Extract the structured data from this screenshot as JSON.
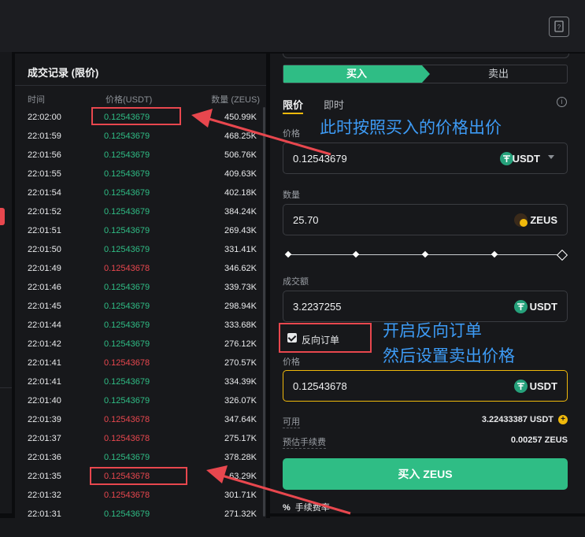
{
  "trades": {
    "title": "成交记录 (限价)",
    "col_time": "时间",
    "col_price": "价格(USDT)",
    "col_qty": "数量 (ZEUS)",
    "rows": [
      {
        "time": "22:02:00",
        "price": "0.12543679",
        "qty": "450.99K",
        "side": "buy"
      },
      {
        "time": "22:01:59",
        "price": "0.12543679",
        "qty": "468.25K",
        "side": "buy"
      },
      {
        "time": "22:01:56",
        "price": "0.12543679",
        "qty": "506.76K",
        "side": "buy"
      },
      {
        "time": "22:01:55",
        "price": "0.12543679",
        "qty": "409.63K",
        "side": "buy"
      },
      {
        "time": "22:01:54",
        "price": "0.12543679",
        "qty": "402.18K",
        "side": "buy"
      },
      {
        "time": "22:01:52",
        "price": "0.12543679",
        "qty": "384.24K",
        "side": "buy"
      },
      {
        "time": "22:01:51",
        "price": "0.12543679",
        "qty": "269.43K",
        "side": "buy"
      },
      {
        "time": "22:01:50",
        "price": "0.12543679",
        "qty": "331.41K",
        "side": "buy"
      },
      {
        "time": "22:01:49",
        "price": "0.12543678",
        "qty": "346.62K",
        "side": "sell"
      },
      {
        "time": "22:01:46",
        "price": "0.12543679",
        "qty": "339.73K",
        "side": "buy"
      },
      {
        "time": "22:01:45",
        "price": "0.12543679",
        "qty": "298.94K",
        "side": "buy"
      },
      {
        "time": "22:01:44",
        "price": "0.12543679",
        "qty": "333.68K",
        "side": "buy"
      },
      {
        "time": "22:01:42",
        "price": "0.12543679",
        "qty": "276.12K",
        "side": "buy"
      },
      {
        "time": "22:01:41",
        "price": "0.12543678",
        "qty": "270.57K",
        "side": "sell"
      },
      {
        "time": "22:01:41",
        "price": "0.12543679",
        "qty": "334.39K",
        "side": "buy"
      },
      {
        "time": "22:01:40",
        "price": "0.12543679",
        "qty": "326.07K",
        "side": "buy"
      },
      {
        "time": "22:01:39",
        "price": "0.12543678",
        "qty": "347.64K",
        "side": "sell"
      },
      {
        "time": "22:01:37",
        "price": "0.12543678",
        "qty": "275.17K",
        "side": "sell"
      },
      {
        "time": "22:01:36",
        "price": "0.12543679",
        "qty": "378.28K",
        "side": "buy"
      },
      {
        "time": "22:01:35",
        "price": "0.12543678",
        "qty": "63.29K",
        "side": "sell"
      },
      {
        "time": "22:01:32",
        "price": "0.12543678",
        "qty": "301.71K",
        "side": "sell"
      },
      {
        "time": "22:01:31",
        "price": "0.12543679",
        "qty": "271.32K",
        "side": "buy"
      }
    ]
  },
  "order": {
    "tab_buy": "买入",
    "tab_sell": "卖出",
    "type_limit": "限价",
    "type_market": "即时",
    "price_label": "价格",
    "price_value": "0.12543679",
    "price_unit": "USDT",
    "qty_label": "数量",
    "qty_value": "25.70",
    "qty_unit": "ZEUS",
    "total_label": "成交额",
    "total_value": "3.2237255",
    "total_unit": "USDT",
    "reverse_label": "反向订单",
    "reverse_checked": true,
    "reverse_price_label": "价格",
    "reverse_price_value": "0.12543678",
    "reverse_price_unit": "USDT",
    "available_label": "可用",
    "available_value": "3.22433387 USDT",
    "fee_est_label": "预估手续费",
    "fee_est_value": "0.00257 ZEUS",
    "submit_label": "买入 ZEUS",
    "fee_rate_label": "手续费率"
  },
  "annotations": {
    "note1": "此时按照买入的价格出价",
    "note2_line1": "开启反向订单",
    "note2_line2": "然后设置卖出价格"
  },
  "colors": {
    "buy_green": "#2fbd85",
    "sell_red": "#e8474e",
    "highlight_red": "#e8474e",
    "annotation_blue": "#3d9bf5",
    "active_border": "#f0b90b"
  },
  "icons": {
    "guide": "book-icon",
    "price_unit": "usdt-icon",
    "qty_unit": "zeus-icon",
    "info": "info-icon",
    "available_add": "plus-icon",
    "fee_rate": "percent-icon"
  }
}
